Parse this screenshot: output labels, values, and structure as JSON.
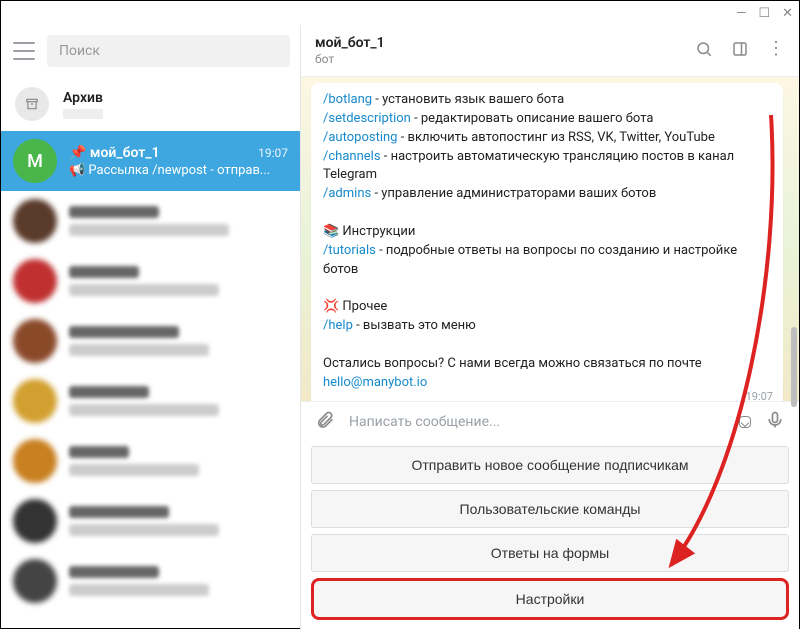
{
  "window": {
    "minimize": "—",
    "maximize": "☐",
    "close": "✕"
  },
  "sidebar": {
    "search_placeholder": "Поиск",
    "archive_label": "Архив",
    "active": {
      "avatar_letter": "M",
      "pin": "📌",
      "name": "мой_бот_1",
      "time": "19:07",
      "icon": "📢",
      "msg": "Рассылка /newpost - отправ..."
    }
  },
  "header": {
    "title": "мой_бот_1",
    "sub": "бот"
  },
  "message": {
    "lines": [
      {
        "cmd": "/botlang",
        "text": " - установить язык вашего бота"
      },
      {
        "cmd": "/setdescription",
        "text": " - редактировать описание вашего бота"
      },
      {
        "cmd": "/autoposting",
        "text": " - включить автопостинг из RSS, VK, Twitter, YouTube"
      },
      {
        "cmd": "/channels",
        "text": " - настроить автоматическую трансляцию постов в канал Telegram"
      },
      {
        "cmd": "/admins",
        "text": " - управление администраторами ваших ботов"
      }
    ],
    "section1_icon": "📚",
    "section1_title": " Инструкции",
    "tutorials_cmd": "/tutorials",
    "tutorials_text": " - подробные ответы на вопросы по созданию и настройке ботов",
    "section2_icon": "💢",
    "section2_title": " Прочее",
    "help_cmd": "/help",
    "help_text": " - вызвать это меню",
    "footer_text": "Остались вопросы? С нами всегда можно связаться по почте ",
    "footer_email": "hello@manybot.io",
    "time": "19:07"
  },
  "input": {
    "placeholder": "Написать сообщение..."
  },
  "keyboard": {
    "b1": "Отправить новое сообщение подписчикам",
    "b2": "Пользовательские команды",
    "b3": "Ответы на формы",
    "b4": "Настройки"
  }
}
